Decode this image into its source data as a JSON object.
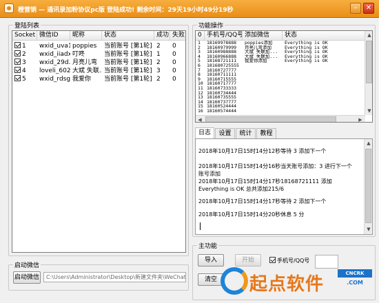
{
  "titlebar": {
    "title": "橙营销 — 通讯录加粉协议pc版    登陆成功!  剩余时间：29天19小时49分19秒",
    "min_glyph": "–",
    "close_glyph": "✕"
  },
  "login_list": {
    "group_label": "登陆列表",
    "columns": [
      "Socket",
      "微信ID",
      "昵称",
      "状态",
      "成功",
      "失败"
    ],
    "rows": [
      {
        "checked": true,
        "socket": "1",
        "wxid": "wxid_uva1...",
        "nick": "poppies",
        "status": "当前账号 [第1轮] ...",
        "success": "2",
        "fail": "0"
      },
      {
        "checked": true,
        "socket": "2",
        "wxid": "wxid_iiadx...",
        "nick": "叮咚",
        "status": "当前账号 [第1轮] ...",
        "success": "1",
        "fail": "0"
      },
      {
        "checked": true,
        "socket": "3",
        "wxid": "wxid_29d...",
        "nick": "月亮儿弯",
        "status": "当前账号 [第1轮] ...",
        "success": "2",
        "fail": "0"
      },
      {
        "checked": true,
        "socket": "4",
        "wxid": "loveli_6022",
        "nick": "大斌 失联...",
        "status": "当前账号 [第1轮] ...",
        "success": "3",
        "fail": "0"
      },
      {
        "checked": true,
        "socket": "5",
        "wxid": "wxid_rdsg...",
        "nick": "我爱你",
        "status": "当前账号 [第1轮] ...",
        "success": "2",
        "fail": "0"
      }
    ]
  },
  "function_ops": {
    "group_label": "功能操作",
    "columns": [
      "0",
      "手机号/QQ号",
      "添加微信",
      "状态"
    ],
    "rows": [
      {
        "idx": "1",
        "phone": "18169978888",
        "wechat": "poppies添加",
        "status": "Everything is OK"
      },
      {
        "idx": "2",
        "phone": "18160979999",
        "wechat": "月亮儿弯添加",
        "status": "Everything is OK"
      },
      {
        "idx": "3",
        "phone": "18160988888",
        "wechat": "大斌 失联加...",
        "status": "Everything is OK"
      },
      {
        "idx": "4",
        "phone": "18160966888",
        "wechat": "大斌 失联加...",
        "status": "Everything is OK"
      },
      {
        "idx": "5",
        "phone": "18168721111",
        "wechat": "我爱你添加",
        "status": "Everything is OK"
      },
      {
        "idx": "6",
        "phone": "181680725555",
        "wechat": "",
        "status": ""
      },
      {
        "idx": "7",
        "phone": "18160727777",
        "wechat": "",
        "status": ""
      },
      {
        "idx": "8",
        "phone": "18160711111",
        "wechat": "",
        "status": ""
      },
      {
        "idx": "9",
        "phone": "18160715555",
        "wechat": "",
        "status": ""
      },
      {
        "idx": "10",
        "phone": "18160717777",
        "wechat": "",
        "status": ""
      },
      {
        "idx": "11",
        "phone": "18160733333",
        "wechat": "",
        "status": ""
      },
      {
        "idx": "12",
        "phone": "18160734444",
        "wechat": "",
        "status": ""
      },
      {
        "idx": "13",
        "phone": "18160735555",
        "wechat": "",
        "status": ""
      },
      {
        "idx": "14",
        "phone": "18160737777",
        "wechat": "",
        "status": ""
      },
      {
        "idx": "15",
        "phone": "18160524444",
        "wechat": "",
        "status": ""
      },
      {
        "idx": "16",
        "phone": "18160574444",
        "wechat": "",
        "status": ""
      }
    ]
  },
  "tabs": [
    "日志",
    "设置",
    "统计",
    "教程"
  ],
  "log": [
    "2018年10月17日15时14分12秒等待 3 添加下一个",
    "2018年10月17日15时14分16秒当天账号添加：3 进行下一个账号添加",
    "2018年10月17日15时14分17秒18168721111 添加 Everything is OK 总共添加215/6",
    "2018年10月17日15时14分17秒等待 2 添加下一个",
    "2018年10月17日15时14分20秒休息 5 分"
  ],
  "startup": {
    "group_label": "启动微信",
    "start_button": "启动微信",
    "path": "C:\\Users\\Administrator\\Desktop\\新建文件夹\\WeChat"
  },
  "main_function": {
    "group_label": "主功能",
    "import_button": "导入",
    "start_button": "开始",
    "clear_button": "清空",
    "checkbox_label": "手机号/QQ号"
  },
  "watermark": {
    "text": "起点软件",
    "badge": "CNCRK",
    "url": ".COM"
  },
  "colors": {
    "titlebar": "#ef9d2a",
    "watermark_orange": "#e7771a",
    "watermark_blue": "#1b72c8"
  }
}
